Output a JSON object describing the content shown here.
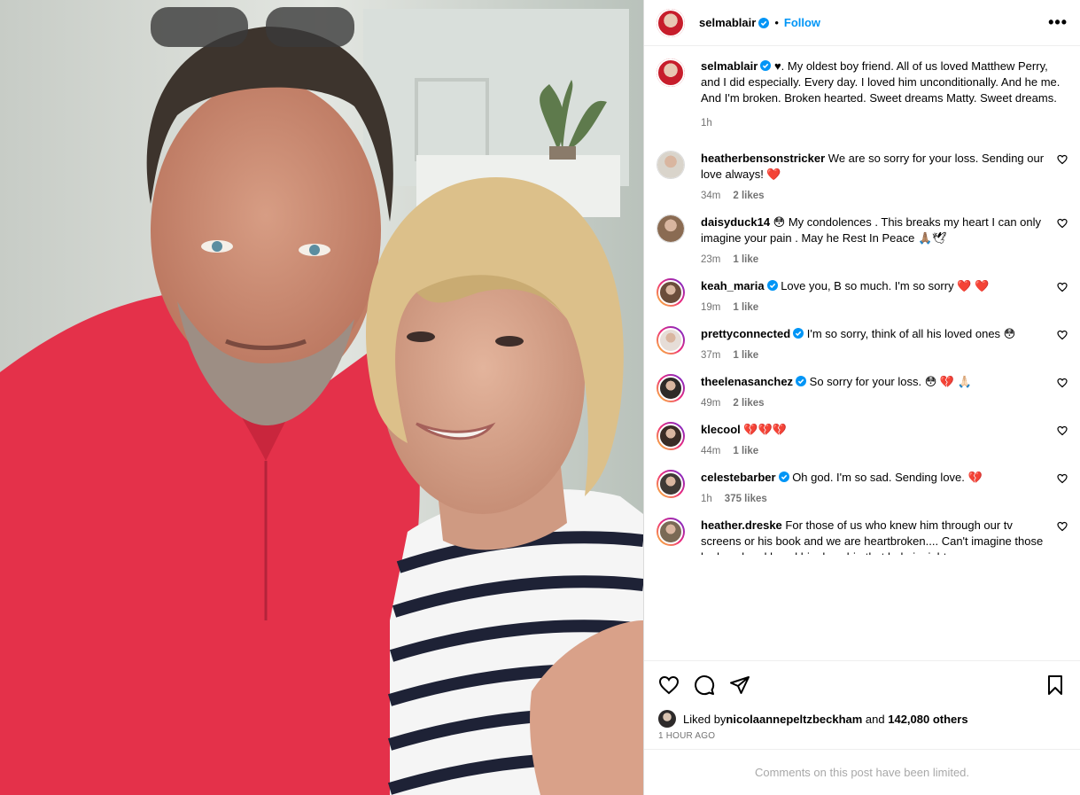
{
  "post": {
    "username": "selmablair",
    "follow_label": "Follow",
    "more_label": "•••"
  },
  "caption": {
    "username": "selmablair",
    "text": " ♥. My oldest boy friend. All of us loved Matthew Perry, and I did especially. Every day. I loved him unconditionally. And he me. And I'm broken. Broken hearted. Sweet dreams Matty. Sweet dreams.",
    "time": "1h"
  },
  "comments": [
    {
      "username": "heatherbensonstricker",
      "verified": false,
      "text": "We are so sorry for your loss. Sending our love always! ❤️",
      "time": "34m",
      "likes": "2 likes",
      "avatar_color": "#d9d4cb",
      "ring": false
    },
    {
      "username": "daisyduck14",
      "verified": false,
      "text": "😳 My condolences . This breaks my heart I can only imagine your pain . May he Rest In Peace 🙏🏽🕊",
      "time": "23m",
      "likes": "1 like",
      "avatar_color": "#8a6b52",
      "ring": false
    },
    {
      "username": "keah_maria",
      "verified": true,
      "text": "Love you, B so much. I'm so sorry ❤️ ❤️",
      "time": "19m",
      "likes": "1 like",
      "avatar_color": "#6b4d3b",
      "ring": true
    },
    {
      "username": "prettyconnected",
      "verified": true,
      "text": "I'm so sorry, think of all his loved ones 😳",
      "time": "37m",
      "likes": "1 like",
      "avatar_color": "#e6ddd7",
      "ring": true
    },
    {
      "username": "theelenasanchez",
      "verified": true,
      "text": "So sorry for your loss. 😳 💔 🙏🏻",
      "time": "49m",
      "likes": "2 likes",
      "avatar_color": "#2e2a28",
      "ring": true
    },
    {
      "username": "klecool",
      "verified": false,
      "text": "💔💔💔",
      "time": "44m",
      "likes": "1 like",
      "avatar_color": "#3a2c25",
      "ring": true
    },
    {
      "username": "celestebarber",
      "verified": true,
      "text": "Oh god. I'm so sad. Sending love. 💔",
      "time": "1h",
      "likes": "375 likes",
      "avatar_color": "#3f3a36",
      "ring": true
    },
    {
      "username": "heather.dreske",
      "verified": false,
      "text": "For those of us who knew him through our tv screens or his book and we are heartbroken.... Can't imagine those he loved and loved him how big that hole is right now.",
      "time": "",
      "likes": "",
      "avatar_color": "#7a6a55",
      "ring": true
    }
  ],
  "liked_by": {
    "prefix": "Liked by ",
    "user": "nicolaannepeltzbeckham",
    "middle": " and ",
    "others": "142,080 others"
  },
  "posted_ago": "1 HOUR AGO",
  "limited_text": "Comments on this post have been limited.",
  "colors": {
    "accent": "#0095f6",
    "verified": "#0095f6",
    "muted": "#737373",
    "heart_red": "#ed4956"
  },
  "icons": {
    "actions": [
      "heart-icon",
      "comment-icon",
      "share-icon",
      "bookmark-icon"
    ]
  }
}
